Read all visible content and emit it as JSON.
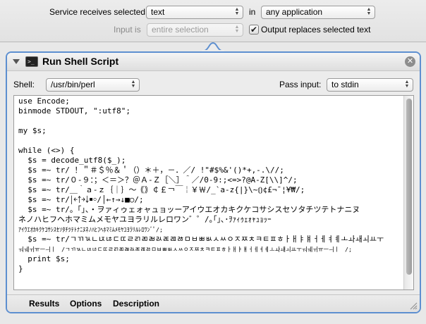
{
  "service": {
    "receives_label": "Service receives selected",
    "receives_value": "text",
    "in_label": "in",
    "in_value": "any application",
    "input_is_label": "Input is",
    "input_is_value": "entire selection",
    "output_replaces_label": "Output replaces selected text",
    "output_replaces_checked": true
  },
  "action": {
    "title": "Run Shell Script",
    "shell_label": "Shell:",
    "shell_value": "/usr/bin/perl",
    "pass_input_label": "Pass input:",
    "pass_input_value": "to stdin",
    "accent_color": "#5d8fd0"
  },
  "script": {
    "lines": [
      "use Encode;",
      "binmode STDOUT, \":utf8\";",
      "",
      "my $s;",
      "",
      "while (<>) {",
      "  $s = decode_utf8($_);",
      "  $s =~ tr/ ！＂＃＄％＆＇（）＊＋，－．／/ !\"#$%&'()*+,-.\\//;",
      "  $s =~ tr/０-９：；＜＝＞？＠Ａ-Ｚ［＼］＾／/0-9:;<=>?@A-Z[\\\\]^/;",
      "  $s =~ tr/＿｀ａ-ｚ｛｜｝～｟｠￠￡￢￣￤￥￦/_`a-z{|}\\~⦅⦆¢£¬¯¦¥₩/;",
      "  $s =~ tr/￨￩￪￫￬￭￮/│←↑→↓■○/;",
      "  $s =~ tr/。「」、・ヲァィゥェォャュョッーアイウエオカキクケコサシスセソタチツテトナニヌ",
      "ネノハヒフヘホマミムメモヤユヨラリルレロワン゛゜/｡｢｣､･ｦｧｨｩｪｫｬｭｮｯｰ",
      "ｱｲｳｴｵｶｷｸｹｺｻｼｽｾｿﾀﾁﾂﾃﾄﾅﾆﾇﾈﾉﾊﾋﾌﾍﾎﾏﾐﾑﾒﾓﾔﾕﾖﾗﾘﾙﾚﾛﾜﾝﾞﾟ/;",
      "  $s =~ tr/ㄱㄲㄳㄴㄵㄶㄷㄸㄹㄺㄻㄼㄽㄾㄿㅀㅁㅂㅃㅄㅅㅆㅇㅈㅉㅊㅋㅌㅍㅎㅏㅐㅑㅒㅓㅔㅕㅖㅗㅘㅙㅚㅛㅜ",
      "ㅝㅞㅟㅠㅡㅢㅣㅤ/ﾡﾢﾣﾤﾥﾦﾧﾨﾩﾪﾫﾬﾭﾮﾯﾰﾱﾲﾳﾴﾵﾶﾷﾸﾹﾺﾻﾼﾽﾾￂￃￄￅￆￇￊￋￌￍￎￏￒￓￔￕￖￗￚￛￜﾠ/;",
      "  print $s;",
      "}"
    ]
  },
  "tabs": {
    "results": "Results",
    "options": "Options",
    "description": "Description"
  },
  "icons": {
    "popup_arrows": "⌃⌄",
    "checkmark": "✔",
    "close": "✕",
    "terminal": ">_"
  }
}
